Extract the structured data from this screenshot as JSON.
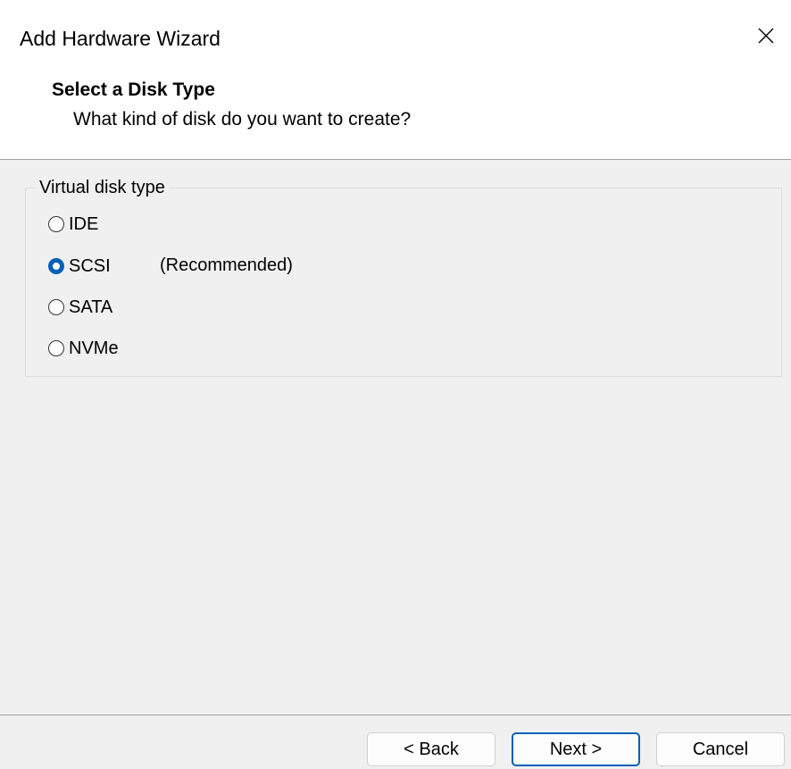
{
  "window": {
    "title": "Add Hardware Wizard"
  },
  "header": {
    "title": "Select a Disk Type",
    "subtitle": "What kind of disk do you want to create?"
  },
  "disk_type_group": {
    "legend": "Virtual disk type",
    "options": [
      {
        "label": "IDE",
        "selected": false,
        "note": ""
      },
      {
        "label": "SCSI",
        "selected": true,
        "note": "(Recommended)"
      },
      {
        "label": "SATA",
        "selected": false,
        "note": ""
      },
      {
        "label": "NVMe",
        "selected": false,
        "note": ""
      }
    ]
  },
  "buttons": {
    "back": "< Back",
    "next": "Next >",
    "cancel": "Cancel"
  },
  "icons": {
    "close": "close-icon"
  },
  "colors": {
    "accent": "#005fb8",
    "content_bg": "#f0f0f0"
  }
}
